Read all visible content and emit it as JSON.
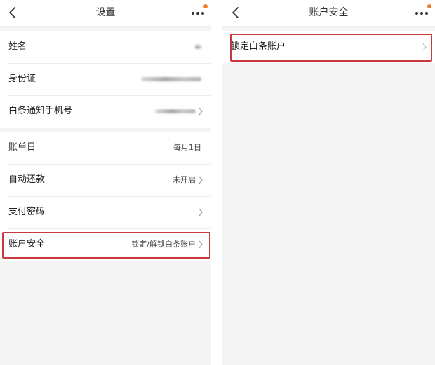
{
  "left_screen": {
    "title": "设置",
    "group1": [
      {
        "label": "姓名"
      },
      {
        "label": "身份证"
      },
      {
        "label": "白条通知手机号"
      }
    ],
    "group2": [
      {
        "label": "账单日",
        "value": "每月1日"
      },
      {
        "label": "自动还款",
        "value": "未开启"
      },
      {
        "label": "支付密码",
        "value": ""
      },
      {
        "label": "账户安全",
        "value": "锁定/解锁白条账户"
      }
    ]
  },
  "right_screen": {
    "title": "账户安全",
    "items": [
      {
        "label": "锁定白条账户"
      }
    ]
  },
  "colors": {
    "notification_dot": "#f07d2a",
    "highlight_border": "#c93a3e",
    "page_background": "#f4f4f4"
  },
  "icons": [
    "back-arrow-icon",
    "more-dots-icon",
    "chevron-right-icon"
  ]
}
